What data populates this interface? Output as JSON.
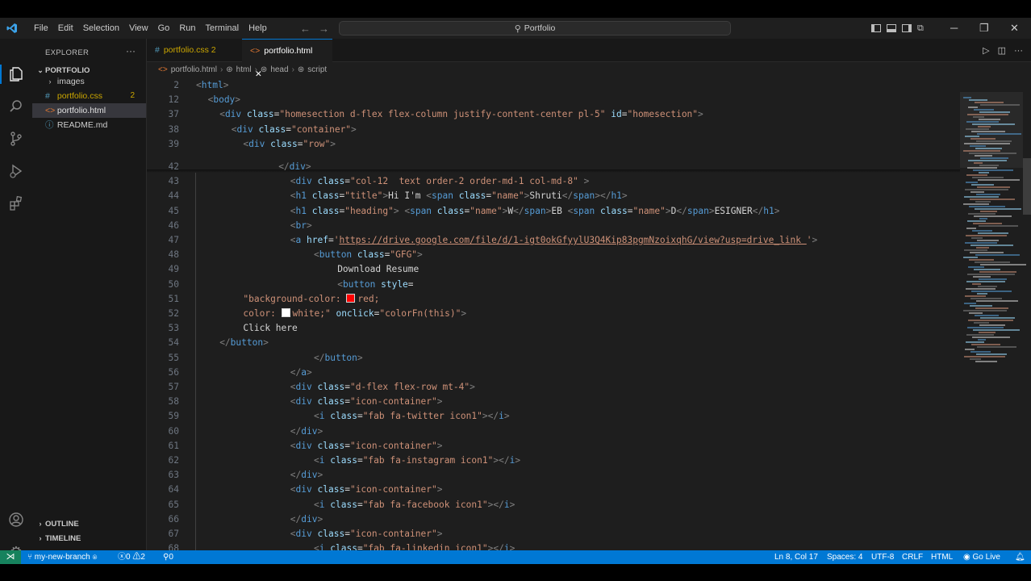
{
  "menu": [
    "File",
    "Edit",
    "Selection",
    "View",
    "Go",
    "Run",
    "Terminal",
    "Help"
  ],
  "search": {
    "text": "Portfolio"
  },
  "explorer": {
    "header": "EXPLORER",
    "root": "PORTFOLIO",
    "items": [
      {
        "label": "images",
        "type": "folder"
      },
      {
        "label": "portfolio.css",
        "type": "css",
        "badge": "2"
      },
      {
        "label": "portfolio.html",
        "type": "html"
      },
      {
        "label": "README.md",
        "type": "md"
      }
    ],
    "outline": "OUTLINE",
    "timeline": "TIMELINE"
  },
  "tabs": [
    {
      "label": "portfolio.css 2",
      "active": false
    },
    {
      "label": "portfolio.html",
      "active": true
    }
  ],
  "breadcrumb": [
    "portfolio.html",
    "html",
    "head",
    "script"
  ],
  "code_lines": [
    {
      "n": "2",
      "indent": 0,
      "parts": [
        [
          "tg",
          "<"
        ],
        [
          "tn",
          "html"
        ],
        [
          "tg",
          ">"
        ]
      ]
    },
    {
      "n": "12",
      "indent": 1,
      "parts": [
        [
          "tg",
          "<"
        ],
        [
          "tn",
          "body"
        ],
        [
          "tg",
          ">"
        ]
      ]
    },
    {
      "n": "37",
      "indent": 2,
      "parts": [
        [
          "tg",
          "<"
        ],
        [
          "tn",
          "div"
        ],
        [
          "tx",
          " "
        ],
        [
          "an",
          "class"
        ],
        [
          "tx",
          "="
        ],
        [
          "av",
          "\"homesection d-flex flex-column justify-content-center pl-5\""
        ],
        [
          "tx",
          " "
        ],
        [
          "an",
          "id"
        ],
        [
          "tx",
          "="
        ],
        [
          "av",
          "\"homesection\""
        ],
        [
          "tg",
          ">"
        ]
      ]
    },
    {
      "n": "38",
      "indent": 3,
      "parts": [
        [
          "tg",
          "<"
        ],
        [
          "tn",
          "div"
        ],
        [
          "tx",
          " "
        ],
        [
          "an",
          "class"
        ],
        [
          "tx",
          "="
        ],
        [
          "av",
          "\"container\""
        ],
        [
          "tg",
          ">"
        ]
      ]
    },
    {
      "n": "39",
      "indent": 4,
      "parts": [
        [
          "tg",
          "<"
        ],
        [
          "tn",
          "div"
        ],
        [
          "tx",
          " "
        ],
        [
          "an",
          "class"
        ],
        [
          "tx",
          "="
        ],
        [
          "av",
          "\"row\""
        ],
        [
          "tg",
          ">"
        ]
      ]
    },
    {
      "n": "42",
      "indent": 7,
      "parts": [
        [
          "tg",
          "</"
        ],
        [
          "tn",
          "div"
        ],
        [
          "tg",
          ">"
        ]
      ]
    },
    {
      "n": "43",
      "indent": 8,
      "parts": [
        [
          "tg",
          "<"
        ],
        [
          "tn",
          "div"
        ],
        [
          "tx",
          " "
        ],
        [
          "an",
          "class"
        ],
        [
          "tx",
          "="
        ],
        [
          "av",
          "\"col-12  text order-2 order-md-1 col-md-8\""
        ],
        [
          "tx",
          " "
        ],
        [
          "tg",
          ">"
        ]
      ]
    },
    {
      "n": "44",
      "indent": 8,
      "parts": [
        [
          "tg",
          "<"
        ],
        [
          "tn",
          "h1"
        ],
        [
          "tx",
          " "
        ],
        [
          "an",
          "class"
        ],
        [
          "tx",
          "="
        ],
        [
          "av",
          "\"title\""
        ],
        [
          "tg",
          ">"
        ],
        [
          "tx",
          "Hi I'm "
        ],
        [
          "tg",
          "<"
        ],
        [
          "tn",
          "span"
        ],
        [
          "tx",
          " "
        ],
        [
          "an",
          "class"
        ],
        [
          "tx",
          "="
        ],
        [
          "av",
          "\"name\""
        ],
        [
          "tg",
          ">"
        ],
        [
          "tx",
          "Shruti"
        ],
        [
          "tg",
          "</"
        ],
        [
          "tn",
          "span"
        ],
        [
          "tg",
          ">"
        ],
        [
          "tg",
          "</"
        ],
        [
          "tn",
          "h1"
        ],
        [
          "tg",
          ">"
        ]
      ]
    },
    {
      "n": "45",
      "indent": 8,
      "parts": [
        [
          "tg",
          "<"
        ],
        [
          "tn",
          "h1"
        ],
        [
          "tx",
          " "
        ],
        [
          "an",
          "class"
        ],
        [
          "tx",
          "="
        ],
        [
          "av",
          "\"heading\""
        ],
        [
          "tg",
          ">"
        ],
        [
          "tx",
          " "
        ],
        [
          "tg",
          "<"
        ],
        [
          "tn",
          "span"
        ],
        [
          "tx",
          " "
        ],
        [
          "an",
          "class"
        ],
        [
          "tx",
          "="
        ],
        [
          "av",
          "\"name\""
        ],
        [
          "tg",
          ">"
        ],
        [
          "tx",
          "W"
        ],
        [
          "tg",
          "</"
        ],
        [
          "tn",
          "span"
        ],
        [
          "tg",
          ">"
        ],
        [
          "tx",
          "EB "
        ],
        [
          "tg",
          "<"
        ],
        [
          "tn",
          "span"
        ],
        [
          "tx",
          " "
        ],
        [
          "an",
          "class"
        ],
        [
          "tx",
          "="
        ],
        [
          "av",
          "\"name\""
        ],
        [
          "tg",
          ">"
        ],
        [
          "tx",
          "D"
        ],
        [
          "tg",
          "</"
        ],
        [
          "tn",
          "span"
        ],
        [
          "tg",
          ">"
        ],
        [
          "tx",
          "ESIGNER"
        ],
        [
          "tg",
          "</"
        ],
        [
          "tn",
          "h1"
        ],
        [
          "tg",
          ">"
        ]
      ]
    },
    {
      "n": "46",
      "indent": 8,
      "parts": [
        [
          "tg",
          "<"
        ],
        [
          "tn",
          "br"
        ],
        [
          "tg",
          ">"
        ]
      ]
    },
    {
      "n": "47",
      "indent": 8,
      "parts": [
        [
          "tg",
          "<"
        ],
        [
          "tn",
          "a"
        ],
        [
          "tx",
          " "
        ],
        [
          "an",
          "href"
        ],
        [
          "tx",
          "="
        ],
        [
          "av",
          "'"
        ],
        [
          "url",
          "https://drive.google.com/file/d/1-igt0okGfyylU3Q4Kip83pgmNzoixqhG/view?usp=drive_link "
        ],
        [
          "av",
          "'"
        ],
        [
          "tg",
          ">"
        ]
      ]
    },
    {
      "n": "48",
      "indent": 10,
      "parts": [
        [
          "tg",
          "<"
        ],
        [
          "tn",
          "button"
        ],
        [
          "tx",
          " "
        ],
        [
          "an",
          "class"
        ],
        [
          "tx",
          "="
        ],
        [
          "av",
          "\"GFG\""
        ],
        [
          "tg",
          ">"
        ]
      ]
    },
    {
      "n": "49",
      "indent": 12,
      "parts": [
        [
          "tx",
          "Download Resume"
        ]
      ]
    },
    {
      "n": "50",
      "indent": 12,
      "parts": [
        [
          "tg",
          "<"
        ],
        [
          "tn",
          "button"
        ],
        [
          "tx",
          " "
        ],
        [
          "an",
          "style"
        ],
        [
          "tx",
          "="
        ]
      ]
    },
    {
      "n": "51",
      "indent": 4,
      "parts": [
        [
          "av",
          "\"background-color: "
        ],
        [
          "sw",
          "#ff0000"
        ],
        [
          "av",
          "red;"
        ]
      ]
    },
    {
      "n": "52",
      "indent": 4,
      "parts": [
        [
          "av",
          "color: "
        ],
        [
          "sw",
          "#ffffff"
        ],
        [
          "av",
          "white;\""
        ],
        [
          "tx",
          " "
        ],
        [
          "an",
          "onclick"
        ],
        [
          "tx",
          "="
        ],
        [
          "av",
          "\"colorFn(this)\""
        ],
        [
          "tg",
          ">"
        ]
      ]
    },
    {
      "n": "53",
      "indent": 4,
      "parts": [
        [
          "tx",
          "Click here"
        ]
      ]
    },
    {
      "n": "54",
      "indent": 2,
      "parts": [
        [
          "tg",
          "</"
        ],
        [
          "tn",
          "button"
        ],
        [
          "tg",
          ">"
        ]
      ]
    },
    {
      "n": "55",
      "indent": 10,
      "parts": [
        [
          "tg",
          "</"
        ],
        [
          "tn",
          "button"
        ],
        [
          "tg",
          ">"
        ]
      ]
    },
    {
      "n": "56",
      "indent": 8,
      "parts": [
        [
          "tg",
          "</"
        ],
        [
          "tn",
          "a"
        ],
        [
          "tg",
          ">"
        ]
      ]
    },
    {
      "n": "57",
      "indent": 8,
      "parts": [
        [
          "tg",
          "<"
        ],
        [
          "tn",
          "div"
        ],
        [
          "tx",
          " "
        ],
        [
          "an",
          "class"
        ],
        [
          "tx",
          "="
        ],
        [
          "av",
          "\"d-flex flex-row mt-4\""
        ],
        [
          "tg",
          ">"
        ]
      ]
    },
    {
      "n": "58",
      "indent": 8,
      "parts": [
        [
          "tg",
          "<"
        ],
        [
          "tn",
          "div"
        ],
        [
          "tx",
          " "
        ],
        [
          "an",
          "class"
        ],
        [
          "tx",
          "="
        ],
        [
          "av",
          "\"icon-container\""
        ],
        [
          "tg",
          ">"
        ]
      ]
    },
    {
      "n": "59",
      "indent": 10,
      "parts": [
        [
          "tg",
          "<"
        ],
        [
          "tn",
          "i"
        ],
        [
          "tx",
          " "
        ],
        [
          "an",
          "class"
        ],
        [
          "tx",
          "="
        ],
        [
          "av",
          "\"fab fa-twitter icon1\""
        ],
        [
          "tg",
          ">"
        ],
        [
          "tg",
          "</"
        ],
        [
          "tn",
          "i"
        ],
        [
          "tg",
          ">"
        ]
      ]
    },
    {
      "n": "60",
      "indent": 8,
      "parts": [
        [
          "tg",
          "</"
        ],
        [
          "tn",
          "div"
        ],
        [
          "tg",
          ">"
        ]
      ]
    },
    {
      "n": "61",
      "indent": 8,
      "parts": [
        [
          "tg",
          "<"
        ],
        [
          "tn",
          "div"
        ],
        [
          "tx",
          " "
        ],
        [
          "an",
          "class"
        ],
        [
          "tx",
          "="
        ],
        [
          "av",
          "\"icon-container\""
        ],
        [
          "tg",
          ">"
        ]
      ]
    },
    {
      "n": "62",
      "indent": 10,
      "parts": [
        [
          "tg",
          "<"
        ],
        [
          "tn",
          "i"
        ],
        [
          "tx",
          " "
        ],
        [
          "an",
          "class"
        ],
        [
          "tx",
          "="
        ],
        [
          "av",
          "\"fab fa-instagram icon1\""
        ],
        [
          "tg",
          ">"
        ],
        [
          "tg",
          "</"
        ],
        [
          "tn",
          "i"
        ],
        [
          "tg",
          ">"
        ]
      ]
    },
    {
      "n": "63",
      "indent": 8,
      "parts": [
        [
          "tg",
          "</"
        ],
        [
          "tn",
          "div"
        ],
        [
          "tg",
          ">"
        ]
      ]
    },
    {
      "n": "64",
      "indent": 8,
      "parts": [
        [
          "tg",
          "<"
        ],
        [
          "tn",
          "div"
        ],
        [
          "tx",
          " "
        ],
        [
          "an",
          "class"
        ],
        [
          "tx",
          "="
        ],
        [
          "av",
          "\"icon-container\""
        ],
        [
          "tg",
          ">"
        ]
      ]
    },
    {
      "n": "65",
      "indent": 10,
      "parts": [
        [
          "tg",
          "<"
        ],
        [
          "tn",
          "i"
        ],
        [
          "tx",
          " "
        ],
        [
          "an",
          "class"
        ],
        [
          "tx",
          "="
        ],
        [
          "av",
          "\"fab fa-facebook icon1\""
        ],
        [
          "tg",
          ">"
        ],
        [
          "tg",
          "</"
        ],
        [
          "tn",
          "i"
        ],
        [
          "tg",
          ">"
        ]
      ]
    },
    {
      "n": "66",
      "indent": 8,
      "parts": [
        [
          "tg",
          "</"
        ],
        [
          "tn",
          "div"
        ],
        [
          "tg",
          ">"
        ]
      ]
    },
    {
      "n": "67",
      "indent": 8,
      "parts": [
        [
          "tg",
          "<"
        ],
        [
          "tn",
          "div"
        ],
        [
          "tx",
          " "
        ],
        [
          "an",
          "class"
        ],
        [
          "tx",
          "="
        ],
        [
          "av",
          "\"icon-container\""
        ],
        [
          "tg",
          ">"
        ]
      ]
    },
    {
      "n": "68",
      "indent": 10,
      "parts": [
        [
          "tg",
          "<"
        ],
        [
          "tn",
          "i"
        ],
        [
          "tx",
          " "
        ],
        [
          "an",
          "class"
        ],
        [
          "tx",
          "="
        ],
        [
          "av",
          "\"fab fa-linkedin icon1\""
        ],
        [
          "tg",
          ">"
        ],
        [
          "tg",
          "</"
        ],
        [
          "tn",
          "i"
        ],
        [
          "tg",
          ">"
        ]
      ]
    }
  ],
  "status": {
    "branch": "my-new-branch",
    "errors": "0",
    "warnings": "2",
    "ports": "0",
    "position": "Ln 8, Col 17",
    "spaces": "Spaces: 4",
    "encoding": "UTF-8",
    "eol": "CRLF",
    "language": "HTML",
    "golive": "Go Live"
  },
  "colors": {
    "accent": "#0078d4",
    "remote": "#16825d",
    "warning": "#cca700"
  }
}
